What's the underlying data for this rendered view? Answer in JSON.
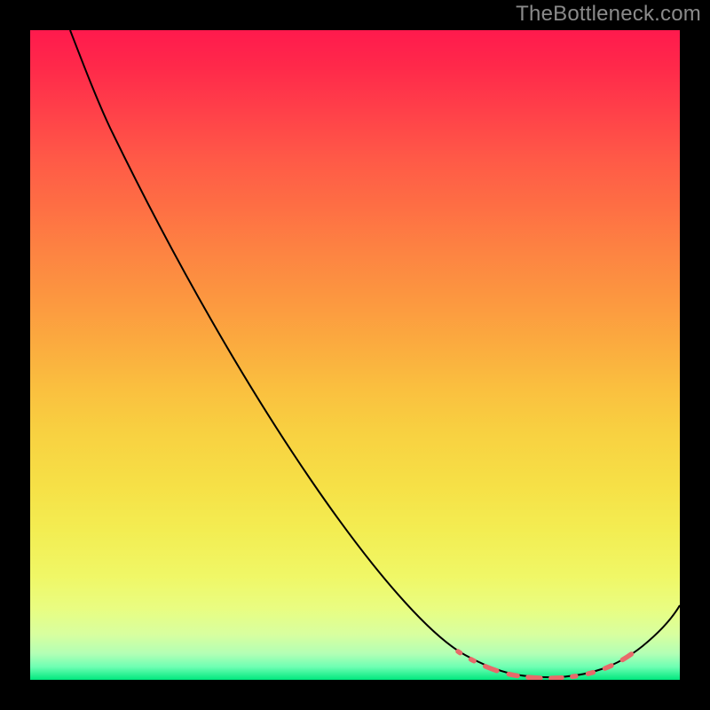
{
  "watermark": {
    "text": "TheBottleneck.com"
  },
  "colors": {
    "frame": "#000000",
    "curve": "#000000",
    "dash": "#e76a6a",
    "gradient_top": "#ff1a4d",
    "gradient_bottom": "#00e87e"
  },
  "chart_data": {
    "type": "line",
    "title": "",
    "xlabel": "",
    "ylabel": "",
    "xlim": [
      0,
      100
    ],
    "ylim": [
      0,
      110
    ],
    "x": [
      0,
      5,
      10,
      20,
      30,
      40,
      50,
      60,
      65,
      70,
      72,
      74,
      76,
      78,
      80,
      82,
      84,
      86,
      88,
      90,
      92,
      94,
      96,
      98,
      100
    ],
    "y": [
      110,
      103,
      97,
      84,
      70,
      55,
      41,
      27,
      20,
      12,
      9,
      6.5,
      4.5,
      3,
      2,
      1.3,
      1,
      1,
      1.4,
      2.3,
      4,
      6.5,
      10,
      15,
      21
    ],
    "highlight_band": {
      "x_start": 72,
      "x_end": 92,
      "description": "optimal range (green)"
    },
    "annotations": [],
    "legend": [],
    "note": "Axis values are estimated from the image; the chart has no visible tick labels."
  }
}
